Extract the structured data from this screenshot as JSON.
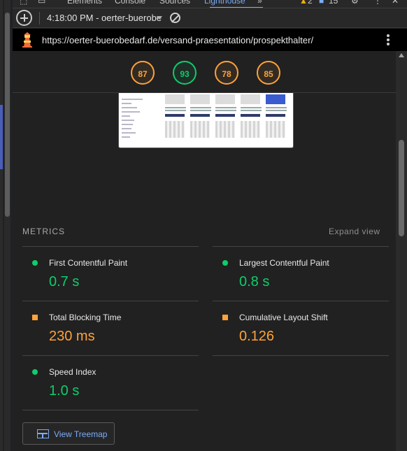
{
  "devtools": {
    "tabs": [
      {
        "label": "Elements"
      },
      {
        "label": "Console"
      },
      {
        "label": "Sources"
      },
      {
        "label": "Lighthouse"
      }
    ],
    "more_tabs": "»",
    "warnings_count": "2",
    "messages_count": "15"
  },
  "toolbar": {
    "report_select": "4:18:00 PM - oerter-buerobe"
  },
  "urlbar": {
    "url": "https://oerter-buerobedarf.de/versand-praesentation/prospekthalter/"
  },
  "scores": [
    {
      "value": "87",
      "status": "average"
    },
    {
      "value": "93",
      "status": "pass"
    },
    {
      "value": "78",
      "status": "average"
    },
    {
      "value": "85",
      "status": "average"
    }
  ],
  "metrics": {
    "header": "METRICS",
    "expand_label": "Expand view",
    "items": [
      {
        "label": "First Contentful Paint",
        "value": "0.7 s",
        "status": "pass"
      },
      {
        "label": "Largest Contentful Paint",
        "value": "0.8 s",
        "status": "pass"
      },
      {
        "label": "Total Blocking Time",
        "value": "230 ms",
        "status": "average"
      },
      {
        "label": "Cumulative Layout Shift",
        "value": "0.126",
        "status": "average"
      },
      {
        "label": "Speed Index",
        "value": "1.0 s",
        "status": "pass"
      }
    ]
  },
  "treemap_button": {
    "label": "View Treemap"
  },
  "colors": {
    "pass": "#0cce6b",
    "average": "#ffa23a",
    "accent": "#7cacf8",
    "background": "#202124"
  }
}
